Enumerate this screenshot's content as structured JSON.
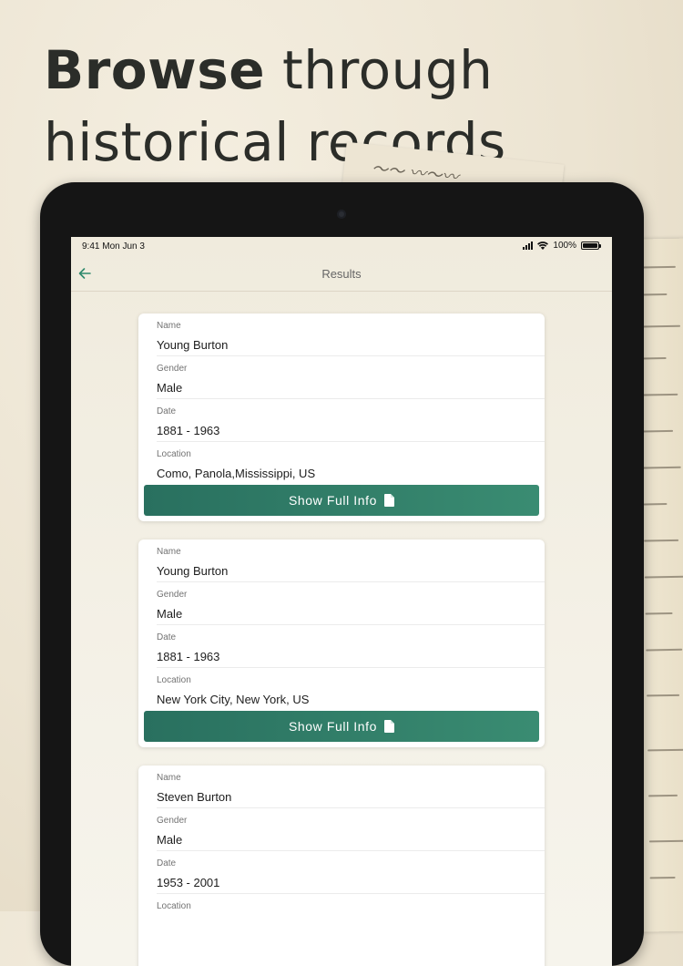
{
  "headline": {
    "bold": "Browse",
    "rest_line1": " through",
    "line2": "historical records"
  },
  "status": {
    "time": "9:41",
    "date": "Mon Jun 3",
    "battery": "100%"
  },
  "nav": {
    "title": "Results"
  },
  "records": [
    {
      "fields": [
        {
          "label": "Name",
          "value": "Young Burton"
        },
        {
          "label": "Gender",
          "value": "Male"
        },
        {
          "label": "Date",
          "value": "1881 - 1963"
        },
        {
          "label": "Location",
          "value": "Como, Panola,Mississippi, US"
        }
      ],
      "button": "Show Full Info"
    },
    {
      "fields": [
        {
          "label": "Name",
          "value": "Young Burton"
        },
        {
          "label": "Gender",
          "value": "Male"
        },
        {
          "label": "Date",
          "value": "1881 - 1963"
        },
        {
          "label": "Location",
          "value": "New York City, New York, US"
        }
      ],
      "button": "Show Full Info"
    },
    {
      "fields": [
        {
          "label": "Name",
          "value": "Steven Burton"
        },
        {
          "label": "Gender",
          "value": "Male"
        },
        {
          "label": "Date",
          "value": "1953 - 2001"
        },
        {
          "label": "Location",
          "value": ""
        }
      ]
    }
  ],
  "colors": {
    "accent": "#2f7a66",
    "button_start": "#29705f",
    "button_end": "#3a8c72"
  }
}
